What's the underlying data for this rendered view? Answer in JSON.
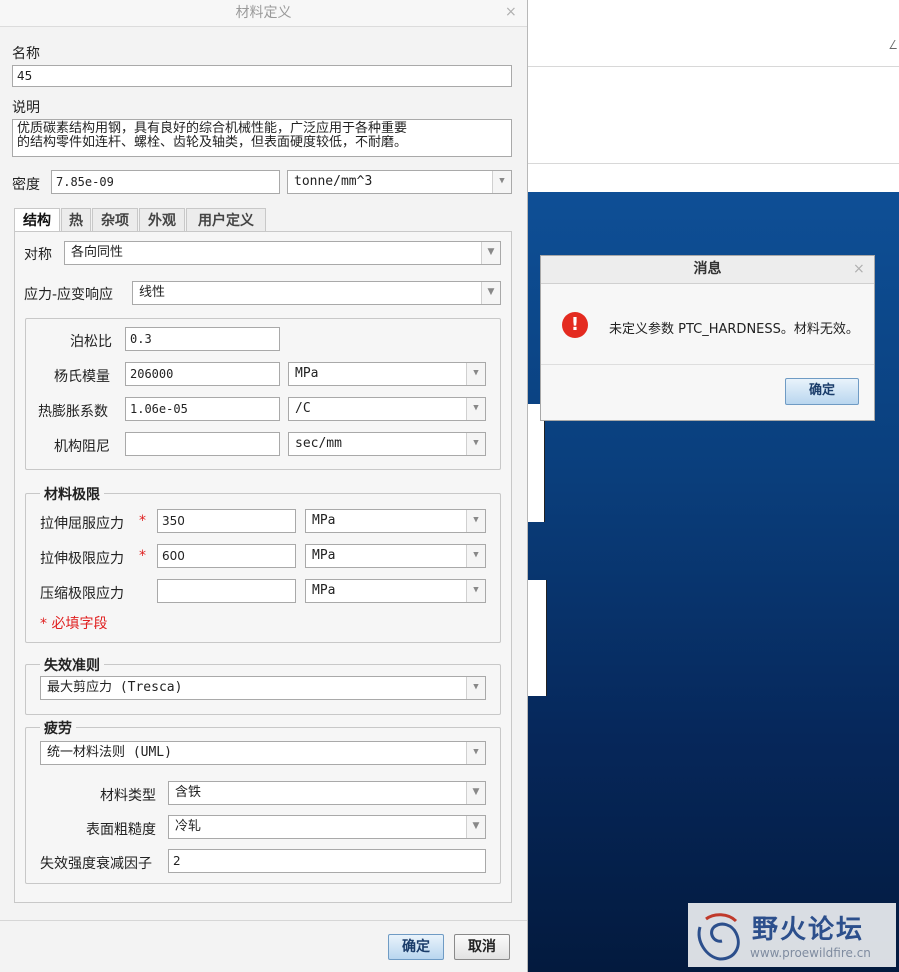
{
  "dialog": {
    "title": "材料定义",
    "close_glyph": "×",
    "name_label": "名称",
    "name_value": "45",
    "description_label": "说明",
    "description_line1": "优质碳素结构用钢，具有良好的综合机械性能，广泛应用于各种重要",
    "description_line2": "的结构零件如连杆、螺栓、齿轮及轴类，但表面硬度较低，不耐磨。",
    "density_label": "密度",
    "density_value": "7.85e-09",
    "density_unit": "tonne/mm^3",
    "tabs": [
      {
        "label": "结构",
        "active": true
      },
      {
        "label": "热",
        "active": false
      },
      {
        "label": "杂项",
        "active": false
      },
      {
        "label": "外观",
        "active": false
      },
      {
        "label": "用户定义",
        "active": false
      }
    ],
    "symmetry_label": "对称",
    "symmetry_value": "各向同性",
    "stress_strain_label": "应力-应变响应",
    "stress_strain_value": "线性",
    "poisson_label": "泊松比",
    "poisson_value": "0.3",
    "youngs_label": "杨氏模量",
    "youngs_value": "206000",
    "youngs_unit": "MPa",
    "thermal_label": "热膨胀系数",
    "thermal_value": "1.06e-05",
    "thermal_unit": "/C",
    "damping_label": "机构阻尼",
    "damping_value": "",
    "damping_unit": "sec/mm",
    "limits_title": "材料极限",
    "tensile_yield_label": "拉伸屈服应力",
    "tensile_yield_value": "350",
    "tensile_yield_unit": "MPa",
    "tensile_ultimate_label": "拉伸极限应力",
    "tensile_ultimate_value": "600",
    "tensile_ultimate_unit": "MPa",
    "compressive_label": "压缩极限应力",
    "compressive_value": "",
    "compressive_unit": "MPa",
    "required_star": "*",
    "required_note": "* 必填字段",
    "failure_title": "失效准则",
    "failure_value": "最大剪应力 (Tresca)",
    "fatigue_title": "疲劳",
    "fatigue_value": "统一材料法则 (UML)",
    "material_type_label": "材料类型",
    "material_type_value": "含铁",
    "surface_label": "表面粗糙度",
    "surface_value": "冷轧",
    "reduction_label": "失效强度衰减因子",
    "reduction_value": "2",
    "ok_label": "确定",
    "cancel_label": "取消"
  },
  "message": {
    "title": "消息",
    "close_glyph": "×",
    "text": "未定义参数 PTC_HARDNESS。材料无效。",
    "icon": "error-icon",
    "icon_glyph": "!",
    "ok_label": "确定"
  },
  "watermark": {
    "name": "野火论坛",
    "url": "www.proewildfire.cn"
  },
  "colors": {
    "canvas_top": "#0e4f96",
    "canvas_bottom": "#031a3e",
    "error_red": "#e42b20",
    "required_red": "#e02020",
    "primary_button": "#b9d6ef"
  }
}
